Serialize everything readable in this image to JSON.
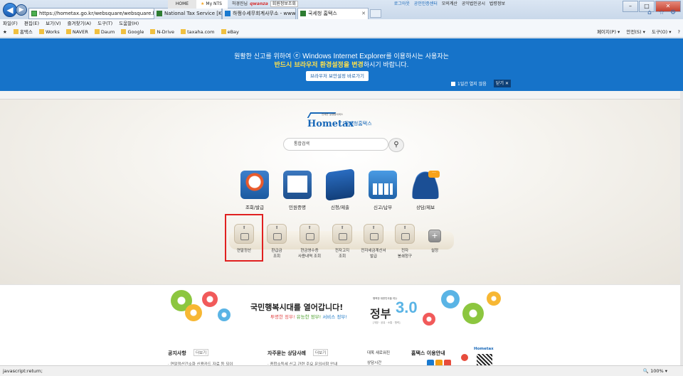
{
  "browser": {
    "address_url": "https://hometax.go.kr/websquare/websquare.html?w2xP",
    "address_secure_label": "National Tax Service [KR]",
    "tabs": [
      {
        "label": "하쩡수세무회계사무소 - www..."
      },
      {
        "label": "국세청 홈택스"
      }
    ],
    "menu": [
      "파일(F)",
      "편집(E)",
      "보기(V)",
      "즐겨찾기(A)",
      "도구(T)",
      "도움말(H)"
    ],
    "favorites": [
      "홈택스",
      "Works",
      "NAVER",
      "Daum",
      "Google",
      "N-Drive",
      "taxaha.com",
      "eBay"
    ],
    "commands": [
      "페이지(P) ▾",
      "안전(S) ▾",
      "도구(O) ▾"
    ],
    "status_text": "javascript:return;",
    "zoom": "100%"
  },
  "notice": {
    "line1_before": "원활한 신고를 위하여",
    "line1_ie": "Windows Internet Explorer",
    "line1_after": "를 이용하시는 사용자는",
    "line2_highlight": "반드시 브라우저 환경설정을 변경",
    "line2_after": "하시기 바랍니다.",
    "settings_button": "브라우저 보안설정 바로가기",
    "dont_show": "1일간 열지 않음",
    "close_button": "닫기 ✕"
  },
  "sitenav": {
    "home": "HOME",
    "my_nts": "My NTS",
    "user_prefix": "허경진님",
    "user_name": "qwanza",
    "member_info": "회원정보조회",
    "right_links": [
      "로그아웃",
      "공인인증센터",
      "모의계산",
      "공익법인공시",
      "법령정보"
    ]
  },
  "logo": {
    "brand": "Hometax",
    "subtitle": "국세청홈택스",
    "tagline": "언제든 실생활서비스"
  },
  "search": {
    "placeholder": "통합검색"
  },
  "main_menu": [
    {
      "label": "조회/발급",
      "icon": "certificate-icon"
    },
    {
      "label": "민원증명",
      "icon": "document-icon"
    },
    {
      "label": "신청/제출",
      "icon": "submit-pen-icon"
    },
    {
      "label": "신고/납부",
      "icon": "calculator-icon"
    },
    {
      "label": "상담/제보",
      "icon": "consult-icon"
    }
  ],
  "quick_menu": [
    {
      "label": "연말정산"
    },
    {
      "label": "환급금\n조회"
    },
    {
      "label": "현금영수증\n사용내역 조회"
    },
    {
      "label": "전자고지\n조회"
    },
    {
      "label": "전자세금계산서\n발급"
    },
    {
      "label": "전자\n봉쇄청구"
    },
    {
      "label": "설정"
    }
  ],
  "banner": {
    "title": "국민행복시대를 열어갑니다!",
    "sub1": "투명한 정부!",
    "sub2": "유능한 정부!",
    "sub3": "서비스 정부!",
    "gov_small": "행복한 대한민국을 여는",
    "gov_word": "정부",
    "gov_version": "3.0",
    "gov_dots": "[개방 · 공유 · 소통 · 협력]"
  },
  "bottom": {
    "notice_title": "공지사항",
    "notice_more": "더보기",
    "notice_line": "· 연말정산간소화 신용카드 자료 등 되이",
    "faq_title": "자주묻는 상담사례",
    "faq_more": "더보기",
    "faq_line": "· 종합소득세 신고 관련 주요 문의사항 안내",
    "new_items": "대목 새로워진",
    "guide_title": "홈택스 이용안내",
    "consult_time": "상담시간",
    "side_brand": "Hometax"
  }
}
